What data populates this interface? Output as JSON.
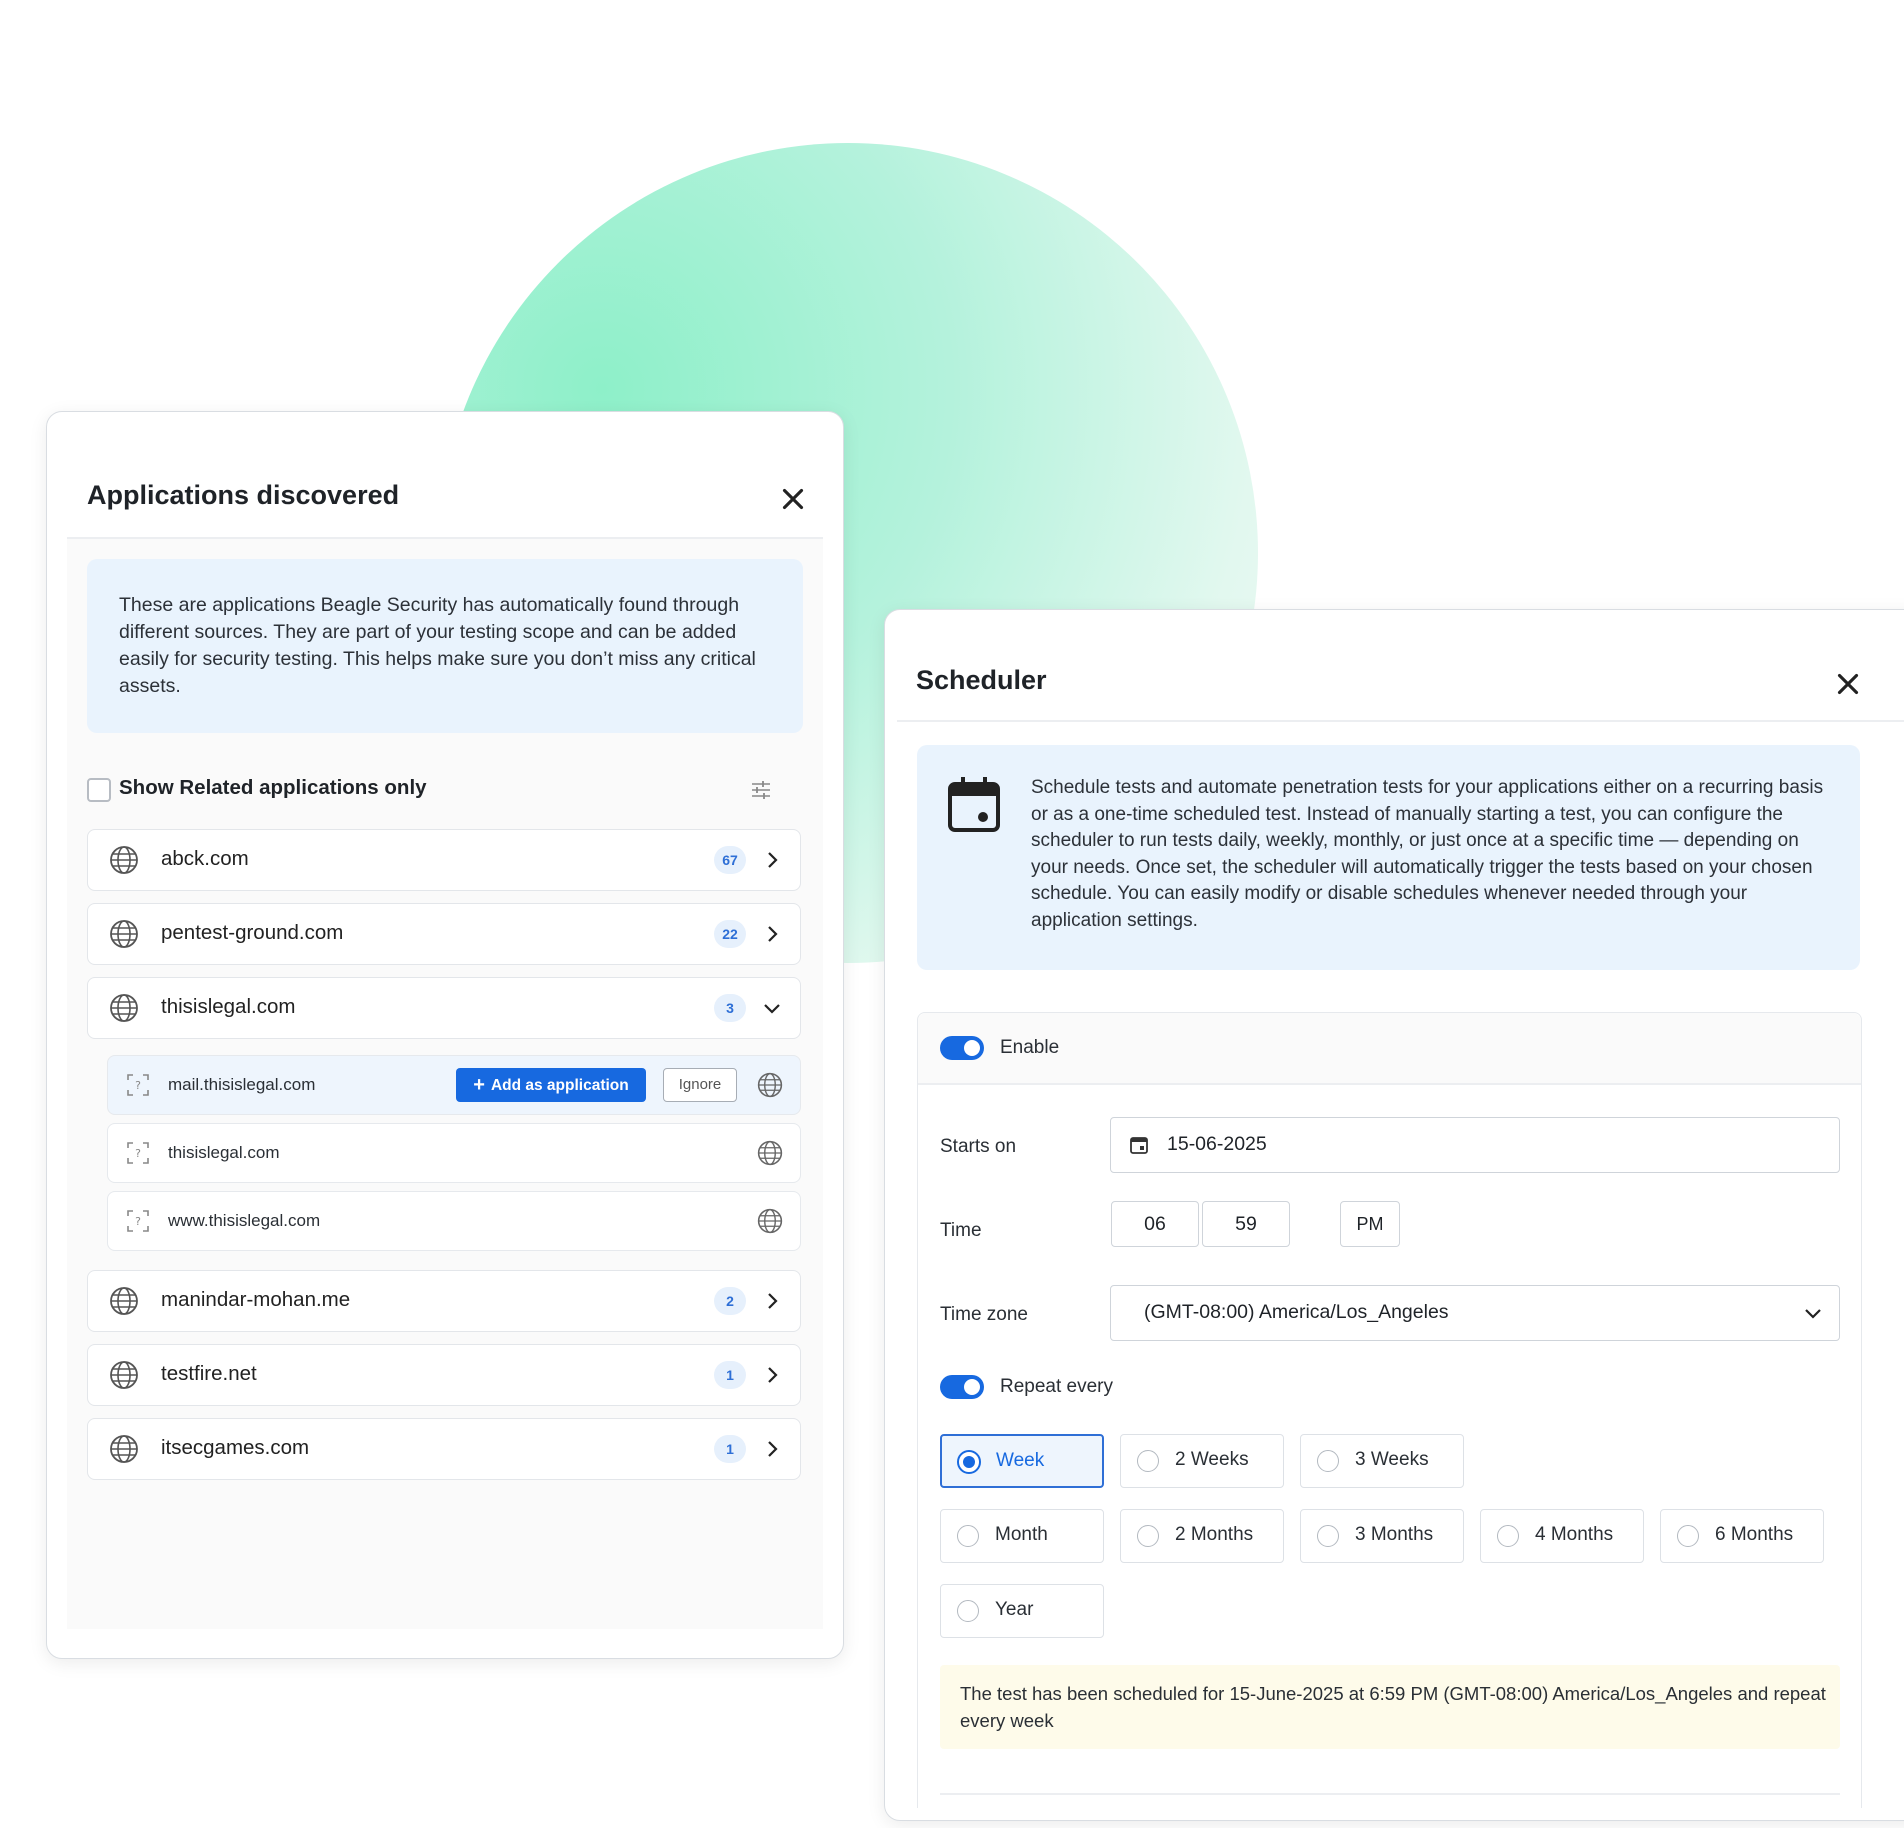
{
  "apps_panel": {
    "title": "Applications discovered",
    "info": "These are applications Beagle Security has automatically found through different sources. They are part of your testing scope and can be added easily for security testing. This helps make sure you don’t miss any critical assets.",
    "filter_label": "Show Related applications only",
    "domains": [
      {
        "name": "abck.com",
        "count": "67"
      },
      {
        "name": "pentest-ground.com",
        "count": "22"
      },
      {
        "name": "thisislegal.com",
        "count": "3"
      },
      {
        "name": "manindar-mohan.me",
        "count": "2"
      },
      {
        "name": "testfire.net",
        "count": "1"
      },
      {
        "name": "itsecgames.com",
        "count": "1"
      }
    ],
    "subdomains": [
      {
        "name": "mail.thisislegal.com"
      },
      {
        "name": "thisislegal.com"
      },
      {
        "name": "www.thisislegal.com"
      }
    ],
    "add_button": "Add as application",
    "ignore_button": "Ignore"
  },
  "scheduler": {
    "title": "Scheduler",
    "info": "Schedule tests and automate penetration tests for your applications either on a recurring basis or as a one-time scheduled test. Instead of manually starting a test, you can configure the scheduler to run tests daily, weekly, monthly, or just once at a specific time — depending on your needs. Once set, the scheduler will automatically trigger the tests based on your chosen schedule. You can easily modify or disable schedules whenever needed through your application settings.",
    "enable_label": "Enable",
    "starts_on_label": "Starts on",
    "starts_on_value": "15-06-2025",
    "time_label": "Time",
    "hour": "06",
    "minute": "59",
    "ampm": "PM",
    "timezone_label": "Time zone",
    "timezone_value": "(GMT-08:00) America/Los_Angeles",
    "repeat_label": "Repeat every",
    "options": [
      "Week",
      "2 Weeks",
      "3 Weeks",
      "Month",
      "2 Months",
      "3 Months",
      "4 Months",
      "6 Months",
      "Year"
    ],
    "selected_option": "Week",
    "notice": "The test has been scheduled for 15-June-2025 at 6:59 PM (GMT-08:00) America/Los_Angeles and repeat every week"
  },
  "colors": {
    "accent": "#1769e0",
    "info_bg": "#e9f3fd",
    "notice_bg": "#fefbea",
    "blob": "#8ef0c9"
  }
}
